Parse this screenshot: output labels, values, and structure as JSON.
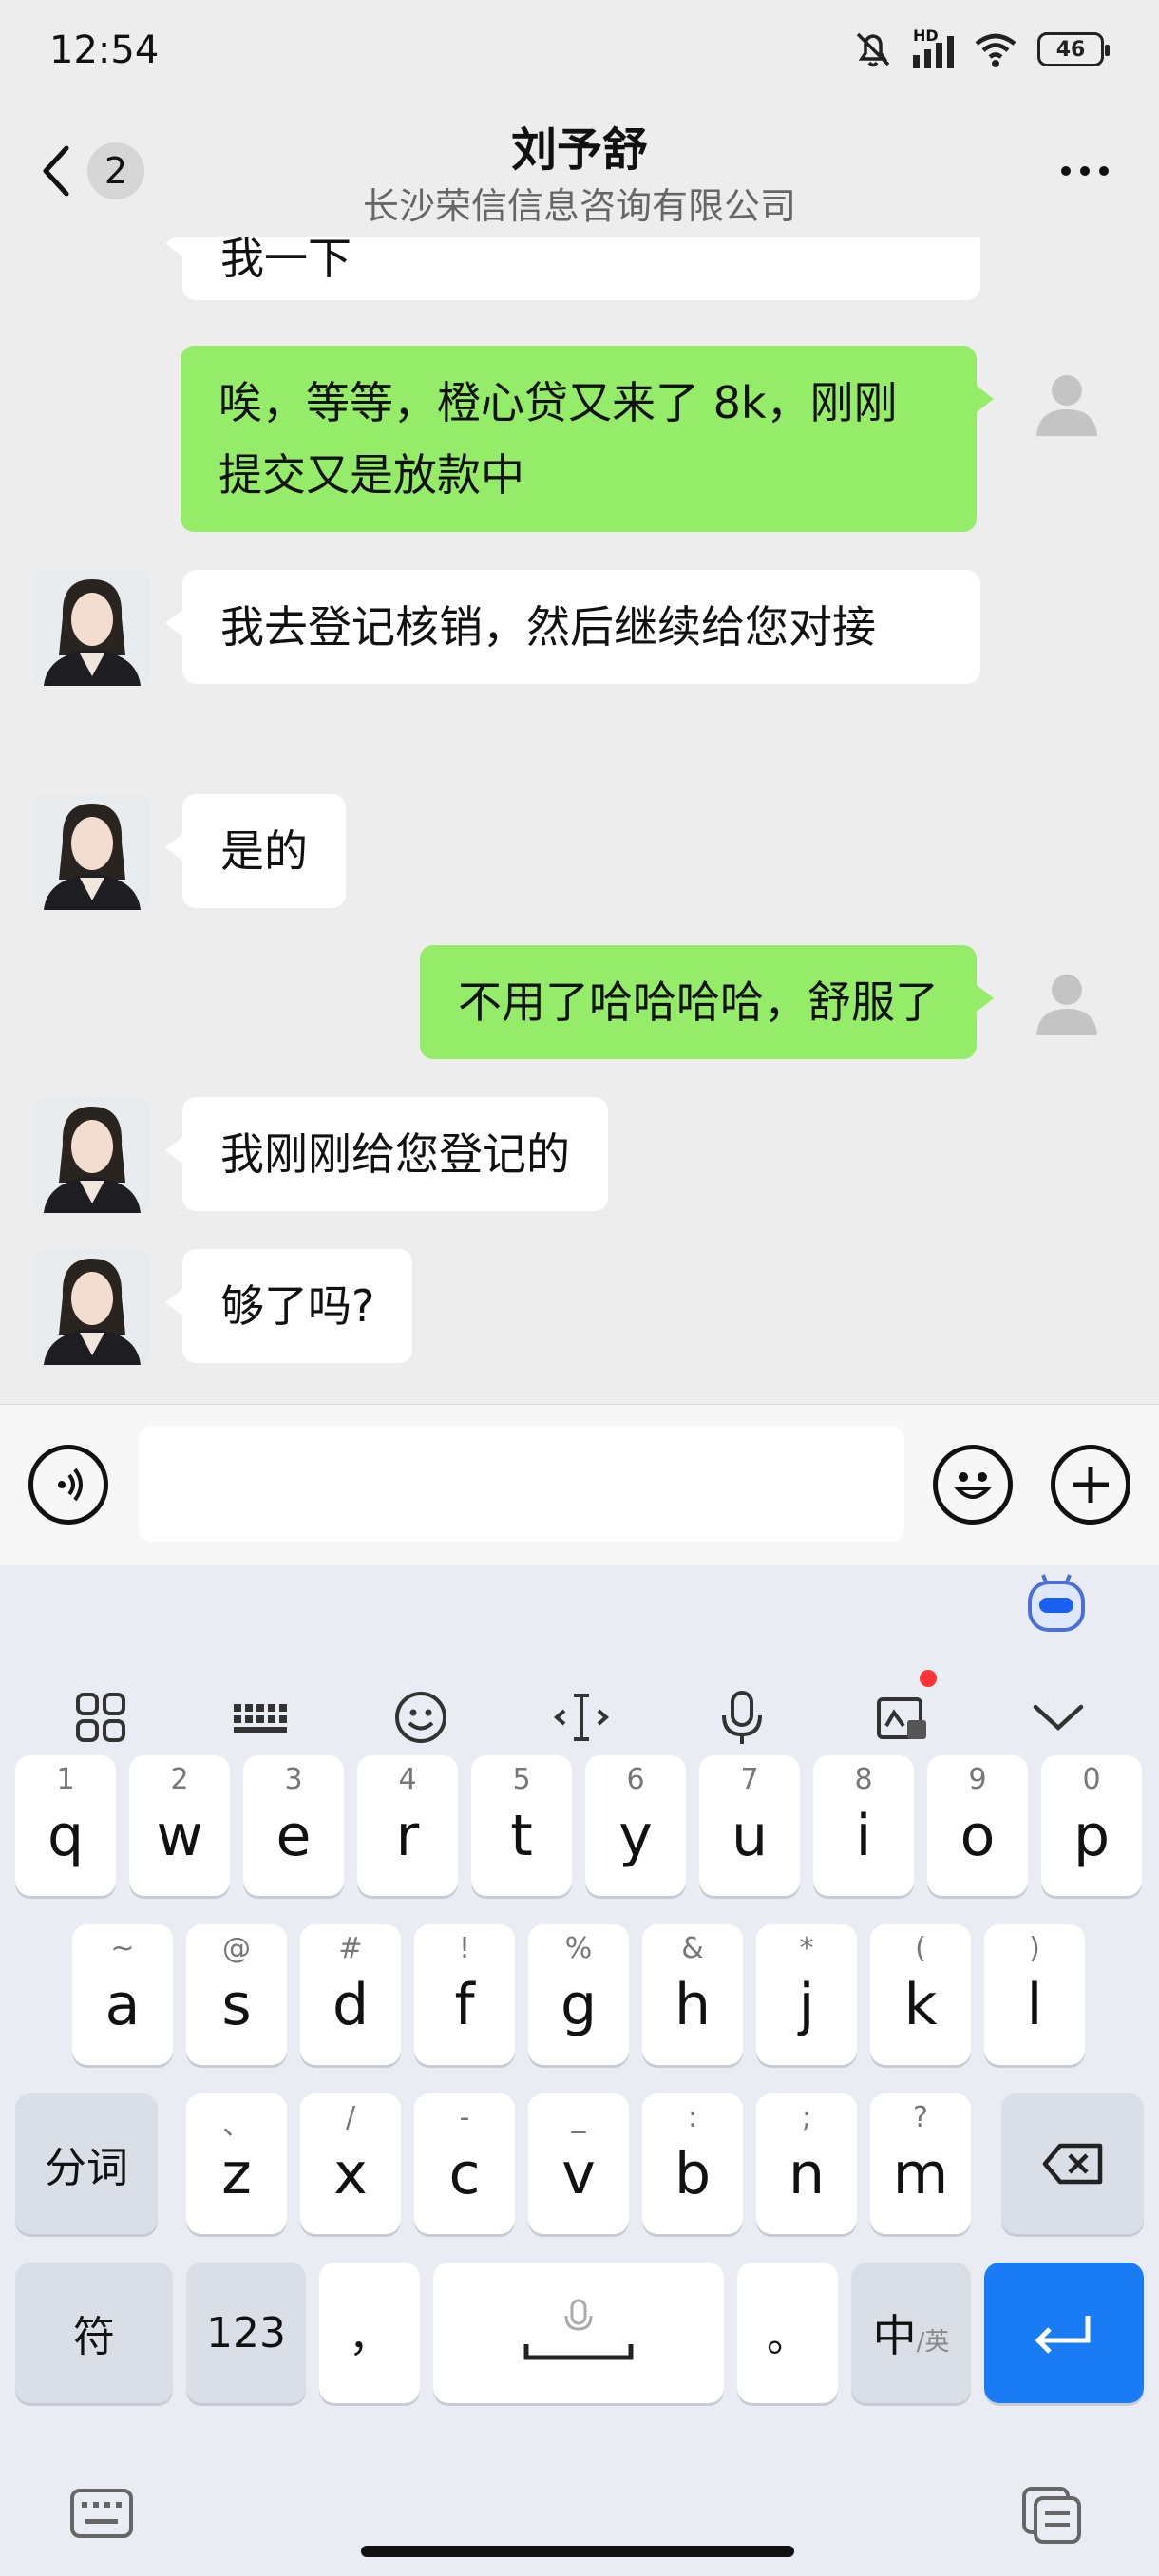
{
  "status_bar": {
    "time": "12:54",
    "network": "HD",
    "battery": "46",
    "icons": [
      "bell-off-icon",
      "signal-icon",
      "wifi-icon",
      "battery-icon"
    ]
  },
  "header": {
    "unread_count": "2",
    "title": "刘予舒",
    "subtitle": "长沙荣信信息咨询有限公司"
  },
  "messages": [
    {
      "side": "in",
      "text": "我一下",
      "partial": true
    },
    {
      "side": "out",
      "text": "唉，等等，橙心贷又来了 8k，刚刚提交又是放款中"
    },
    {
      "side": "in",
      "text": "我去登记核销，然后继续给您对接"
    },
    {
      "side": "in",
      "text": "是的"
    },
    {
      "side": "out",
      "text": "不用了哈哈哈哈，舒服了"
    },
    {
      "side": "in",
      "text": "我刚刚给您登记的"
    },
    {
      "side": "in",
      "text": "够了吗?"
    }
  ],
  "input": {
    "value": "",
    "voice_icon": "voice-icon",
    "emoji_icon": "emoji-icon",
    "plus_icon": "plus-icon"
  },
  "keyboard": {
    "toolbar": [
      "apps-icon",
      "keyboard-layout-icon",
      "emoji-icon",
      "cursor-icon",
      "mic-icon",
      "media-icon",
      "collapse-icon"
    ],
    "row1": [
      {
        "hint": "1",
        "key": "q"
      },
      {
        "hint": "2",
        "key": "w"
      },
      {
        "hint": "3",
        "key": "e"
      },
      {
        "hint": "4",
        "key": "r"
      },
      {
        "hint": "5",
        "key": "t"
      },
      {
        "hint": "6",
        "key": "y"
      },
      {
        "hint": "7",
        "key": "u"
      },
      {
        "hint": "8",
        "key": "i"
      },
      {
        "hint": "9",
        "key": "o"
      },
      {
        "hint": "0",
        "key": "p"
      }
    ],
    "row2": [
      {
        "hint": "~",
        "key": "a"
      },
      {
        "hint": "@",
        "key": "s"
      },
      {
        "hint": "#",
        "key": "d"
      },
      {
        "hint": "!",
        "key": "f"
      },
      {
        "hint": "%",
        "key": "g"
      },
      {
        "hint": "&",
        "key": "h"
      },
      {
        "hint": "*",
        "key": "j"
      },
      {
        "hint": "(",
        "key": "k"
      },
      {
        "hint": ")",
        "key": "l"
      }
    ],
    "row3_left": "分词",
    "row3": [
      {
        "hint": "、",
        "key": "z"
      },
      {
        "hint": "/",
        "key": "x"
      },
      {
        "hint": "-",
        "key": "c"
      },
      {
        "hint": "_",
        "key": "v"
      },
      {
        "hint": ":",
        "key": "b"
      },
      {
        "hint": ";",
        "key": "n"
      },
      {
        "hint": "?",
        "key": "m"
      }
    ],
    "row4": {
      "symbols": "符",
      "numbers": "123",
      "comma": "，",
      "period": "。",
      "lang_main": "中",
      "lang_sub": "/英"
    }
  }
}
